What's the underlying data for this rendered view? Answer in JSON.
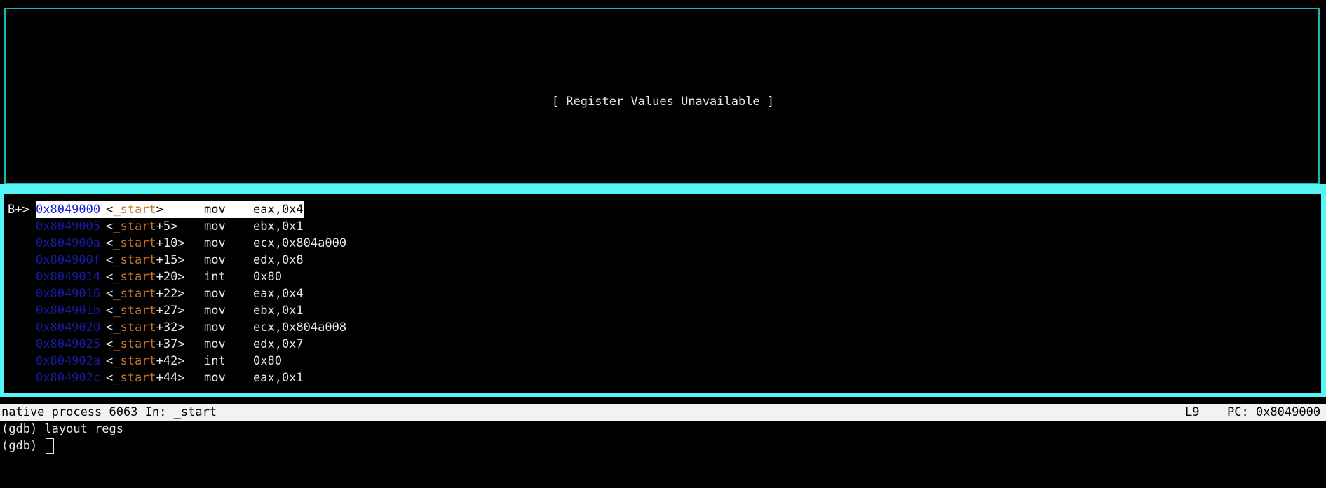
{
  "registers_window": {
    "message": "[ Register Values Unavailable ]"
  },
  "asm_window": {
    "lines": [
      {
        "marker": "B+>",
        "addr": "0x8049000",
        "sym_open": "<",
        "fn": "_start",
        "offset": "",
        "sym_close": ">",
        "op": "mov",
        "args": "eax,0x4",
        "current": true
      },
      {
        "marker": "",
        "addr": "0x8049005",
        "sym_open": "<",
        "fn": "_start",
        "offset": "+5",
        "sym_close": ">",
        "op": "mov",
        "args": "ebx,0x1",
        "current": false
      },
      {
        "marker": "",
        "addr": "0x804900a",
        "sym_open": "<",
        "fn": "_start",
        "offset": "+10",
        "sym_close": ">",
        "op": "mov",
        "args": "ecx,0x804a000",
        "current": false
      },
      {
        "marker": "",
        "addr": "0x804900f",
        "sym_open": "<",
        "fn": "_start",
        "offset": "+15",
        "sym_close": ">",
        "op": "mov",
        "args": "edx,0x8",
        "current": false
      },
      {
        "marker": "",
        "addr": "0x8049014",
        "sym_open": "<",
        "fn": "_start",
        "offset": "+20",
        "sym_close": ">",
        "op": "int",
        "args": "0x80",
        "current": false
      },
      {
        "marker": "",
        "addr": "0x8049016",
        "sym_open": "<",
        "fn": "_start",
        "offset": "+22",
        "sym_close": ">",
        "op": "mov",
        "args": "eax,0x4",
        "current": false
      },
      {
        "marker": "",
        "addr": "0x804901b",
        "sym_open": "<",
        "fn": "_start",
        "offset": "+27",
        "sym_close": ">",
        "op": "mov",
        "args": "ebx,0x1",
        "current": false
      },
      {
        "marker": "",
        "addr": "0x8049020",
        "sym_open": "<",
        "fn": "_start",
        "offset": "+32",
        "sym_close": ">",
        "op": "mov",
        "args": "ecx,0x804a008",
        "current": false
      },
      {
        "marker": "",
        "addr": "0x8049025",
        "sym_open": "<",
        "fn": "_start",
        "offset": "+37",
        "sym_close": ">",
        "op": "mov",
        "args": "edx,0x7",
        "current": false
      },
      {
        "marker": "",
        "addr": "0x804902a",
        "sym_open": "<",
        "fn": "_start",
        "offset": "+42",
        "sym_close": ">",
        "op": "int",
        "args": "0x80",
        "current": false
      },
      {
        "marker": "",
        "addr": "0x804902c",
        "sym_open": "<",
        "fn": "_start",
        "offset": "+44",
        "sym_close": ">",
        "op": "mov",
        "args": "eax,0x1",
        "current": false
      }
    ]
  },
  "status_bar": {
    "left": "native process 6063 In: _start",
    "line": "L9",
    "pc": "PC: 0x8049000"
  },
  "command": {
    "history": [
      "(gdb) layout regs"
    ],
    "prompt": "(gdb) "
  },
  "colors": {
    "frame": "#55f5f5",
    "address": "#2020c8",
    "function": "#c8752a"
  }
}
